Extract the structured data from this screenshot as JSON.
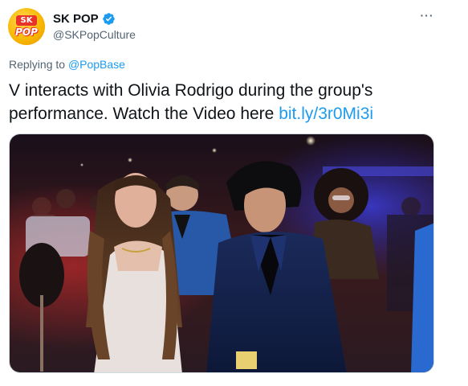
{
  "account": {
    "display_name": "SK POP",
    "handle": "@SKPopCulture",
    "avatar_top_text": "SK",
    "avatar_bottom_text": "POP",
    "verified": true
  },
  "reply": {
    "prefix": "Replying to ",
    "to_handle": "@PopBase"
  },
  "tweet": {
    "text_line1": "V interacts with Olivia Rodrigo during the group's",
    "text_line2_prefix": "performance. Watch the Video here ",
    "link_text": "bit.ly/3r0Mi3i"
  },
  "icons": {
    "more": "more-options-icon",
    "verified": "verified-badge-icon"
  },
  "colors": {
    "link": "#1d9bf0",
    "secondary_text": "#536471",
    "primary_text": "#0f1419"
  }
}
